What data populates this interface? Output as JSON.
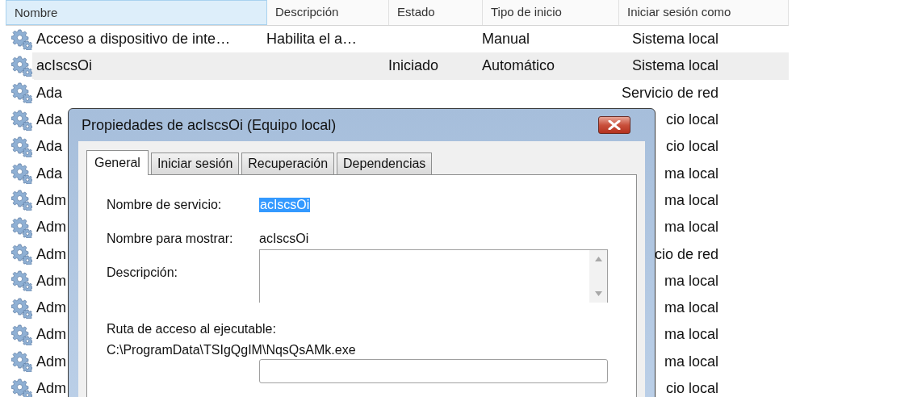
{
  "table": {
    "columns": [
      "Nombre",
      "Descripción",
      "Estado",
      "Tipo de inicio",
      "Iniciar sesión como"
    ],
    "rows": [
      {
        "name": "Acceso a dispositivo de inte…",
        "description": "Habilita el a…",
        "start_type": "Manual",
        "logon": "Sistema local",
        "selected": false
      },
      {
        "name": "acIscsOi",
        "status": "Iniciado",
        "start_type": "Automático",
        "logon": "Sistema local",
        "selected": true
      },
      {
        "name": "Ada",
        "logon": "Servicio de red",
        "selected": false
      },
      {
        "name": "Ada",
        "logon": "cio local",
        "selected": false
      },
      {
        "name": "Ada",
        "logon": "cio local",
        "selected": false
      },
      {
        "name": "Ada",
        "logon": "ma local",
        "selected": false
      },
      {
        "name": "Adm",
        "logon": "ma local",
        "selected": false
      },
      {
        "name": "Adm",
        "logon": "ma local",
        "selected": false
      },
      {
        "name": "Adm",
        "logon": "cio de red",
        "selected": false
      },
      {
        "name": "Adm",
        "logon": "ma local",
        "selected": false
      },
      {
        "name": "Adm",
        "logon": "ma local",
        "selected": false
      },
      {
        "name": "Adm",
        "logon": "ma local",
        "selected": false
      },
      {
        "name": "Adm",
        "logon": "ma local",
        "selected": false
      },
      {
        "name": "Adm",
        "logon": "cio local",
        "selected": false
      }
    ]
  },
  "dialog": {
    "title": "Propiedades de acIscsOi (Equipo local)",
    "tabs": [
      {
        "label": "General",
        "selected": true
      },
      {
        "label": "Iniciar sesión",
        "selected": false
      },
      {
        "label": "Recuperación",
        "selected": false
      },
      {
        "label": "Dependencias",
        "selected": false
      }
    ],
    "fields": [
      {
        "kind": "value",
        "label": "Nombre de servicio:",
        "value": "acIscsOi",
        "highlighted": true
      },
      {
        "kind": "value",
        "label": "Nombre para mostrar:",
        "value": "acIscsOi",
        "highlighted": false
      },
      {
        "kind": "textarea",
        "label": "Descripción:"
      },
      {
        "kind": "path",
        "label": "Ruta de acceso al ejecutable:",
        "value": "C:\\ProgramData\\TSIgQgIM\\NqsQsAMk.exe"
      },
      {
        "kind": "input"
      }
    ]
  }
}
